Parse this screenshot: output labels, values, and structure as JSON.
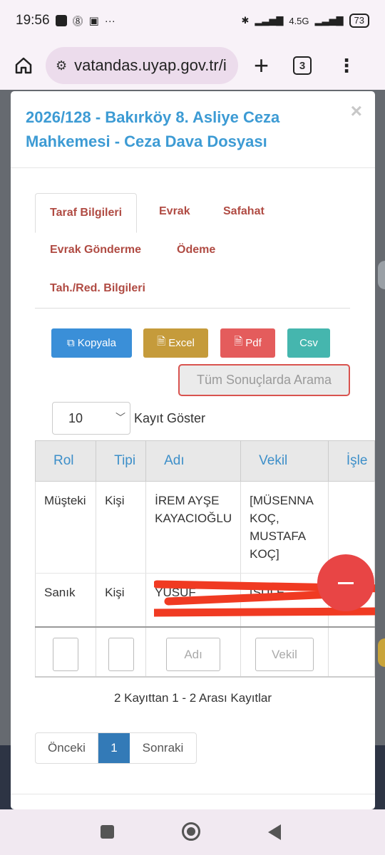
{
  "status_bar": {
    "time": "19:56",
    "battery": "73",
    "network": "4.5G"
  },
  "browser": {
    "url": "vatandas.uyap.gov.tr/i",
    "tab_count": "3"
  },
  "modal": {
    "title": "2026/128 - Bakırköy 8. Asliye Ceza Mahkemesi - Ceza Dava Dosyası",
    "close": "×",
    "tabs": [
      "Taraf Bilgileri",
      "Evrak",
      "Safahat",
      "Evrak Gönderme",
      "Ödeme",
      "Tah./Red. Bilgileri"
    ],
    "active_tab": "Taraf Bilgileri",
    "export_buttons": {
      "copy": "Kopyala",
      "excel": "Excel",
      "pdf": "Pdf",
      "csv": "Csv"
    },
    "search_all": "Tüm Sonuçlarda Arama",
    "length": {
      "value": "10",
      "label": "Kayıt Göster"
    },
    "table": {
      "columns": [
        "Rol",
        "Tipi",
        "Adı",
        "Vekil",
        "İşle"
      ],
      "rows": [
        {
          "rol": "Müşteki",
          "tipi": "Kişi",
          "adi": "İREM AYŞE KAYACIOĞLU",
          "vekil": "[MÜSENNA KOÇ, MUSTAFA KOÇ]"
        },
        {
          "rol": "Sanık",
          "tipi": "Kişi",
          "adi": "YUSUF",
          "vekil": "[ŞULE"
        }
      ],
      "filters": {
        "adi": "Adı",
        "vekil": "Vekil"
      }
    },
    "info": "2 Kayıttan 1 - 2 Arası Kayıtlar",
    "pagination": {
      "prev": "Önceki",
      "current": "1",
      "next": "Sonraki"
    }
  },
  "colors": {
    "title": "#3d9bd4",
    "tab": "#b04b43",
    "copy": "#3a8fd8",
    "excel": "#c59b3b",
    "pdf": "#e45c5c",
    "csv": "#45b6ae",
    "fab": "#e84545",
    "page_active": "#337ab7"
  }
}
